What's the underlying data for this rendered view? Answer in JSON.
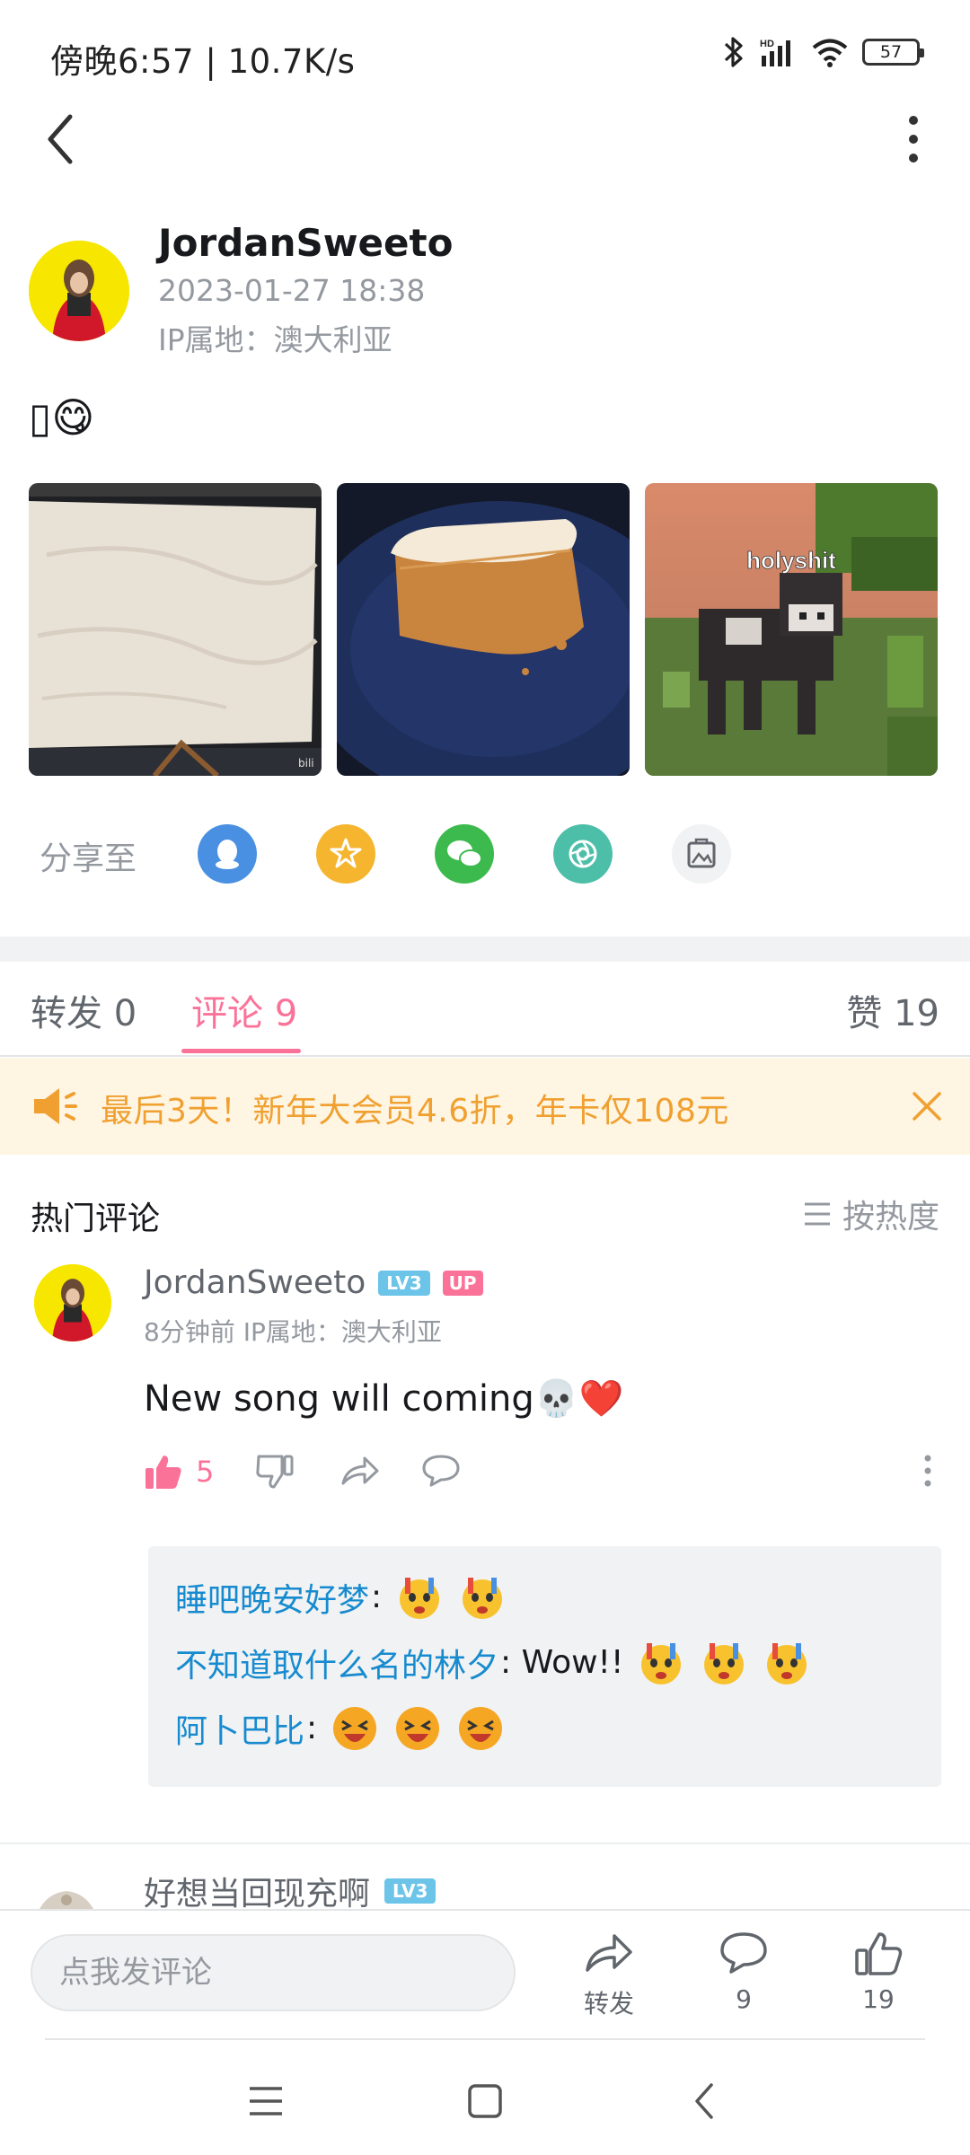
{
  "status_bar": {
    "time_speed": "傍晚6:57 | 10.7K/s",
    "battery": "57"
  },
  "post": {
    "author": "JordanSweeto",
    "time": "2023-01-27 18:38",
    "ip": "IP属地：澳大利亚",
    "text": "▯😋",
    "images": [
      {
        "name": "frosted-cake-pan"
      },
      {
        "name": "cake-slice"
      },
      {
        "name": "minecraft-cow",
        "caption": "holyshit"
      }
    ]
  },
  "share": {
    "label": "分享至",
    "targets": [
      {
        "name": "qq-share",
        "color": "#4a90e2"
      },
      {
        "name": "qzone-share",
        "color": "#f5b52e"
      },
      {
        "name": "wechat-share",
        "color": "#3dba4e"
      },
      {
        "name": "moments-share",
        "color": "#4dbfa8"
      },
      {
        "name": "save-image-share",
        "color": "#f1f2f3"
      }
    ]
  },
  "tabs": {
    "repost": "转发 0",
    "comments": "评论 9",
    "likes": "赞 19"
  },
  "promo": {
    "text": "最后3天！新年大会员4.6折，年卡仅108元"
  },
  "comments": {
    "section_title": "热门评论",
    "sort_label": "按热度",
    "items": [
      {
        "user": "JordanSweeto",
        "level": "LV3",
        "up_badge": "UP",
        "meta": "8分钟前 IP属地：澳大利亚",
        "text": "New song will coming💀❤️",
        "likes": "5",
        "replies": [
          {
            "user": "睡吧晚安好梦",
            "body": ":"
          },
          {
            "user": "不知道取什么名的林夕",
            "body": ": Wow!!"
          },
          {
            "user": "阿卜巴比",
            "body": ":"
          }
        ]
      },
      {
        "user": "好想当回现充啊",
        "level": "LV3"
      }
    ]
  },
  "bottom_bar": {
    "input_placeholder": "点我发评论",
    "repost_label": "转发",
    "comment_count": "9",
    "like_count": "19"
  }
}
